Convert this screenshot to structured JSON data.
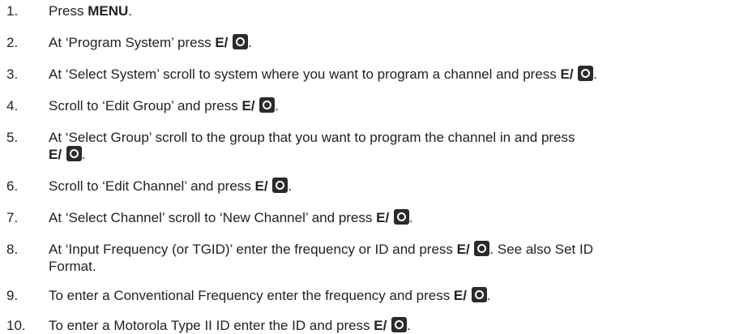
{
  "steps": [
    {
      "number": "1.",
      "pre": "Press ",
      "key": "MENU",
      "post": "."
    },
    {
      "number": "2.",
      "pre": "At ‘Program System’ press ",
      "key": "E/",
      "icon": "enter-button-icon",
      "post": "."
    },
    {
      "number": "3.",
      "pre": "At ‘Select System’ scroll to system where you want to program a channel and press ",
      "key": "E/",
      "icon": "enter-button-icon",
      "post": "."
    },
    {
      "number": "4.",
      "pre": "Scroll to ‘Edit Group’ and press ",
      "key": "E/",
      "icon": "enter-button-icon",
      "post": "."
    },
    {
      "number": "5.",
      "pre": "At ‘Select Group’ scroll to the group that you want to program the channel in and press",
      "key": "E/",
      "icon": "enter-button-icon",
      "post": "."
    },
    {
      "number": "6.",
      "pre": "Scroll to ‘Edit Channel’ and press ",
      "key": "E/",
      "icon": "enter-button-icon",
      "post": "."
    },
    {
      "number": "7.",
      "pre": "At ‘Select Channel’ scroll to ‘New Channel’ and press ",
      "key": "E/",
      "icon": "enter-button-icon",
      "post": "."
    },
    {
      "number": "8.",
      "pre": "At ‘Input Frequency (or TGID)’ enter the frequency or ID and press ",
      "key": "E/",
      "icon": "enter-button-icon",
      "post": ". See also Set ID",
      "post2": "Format."
    },
    {
      "number": "9.",
      "pre": "To enter a Conventional Frequency enter the frequency and press ",
      "key": "E/",
      "icon": "enter-button-icon",
      "post": "."
    },
    {
      "number": "10.",
      "pre": "To enter a Motorola Type II ID enter the ID and press ",
      "key": "E/",
      "icon": "enter-button-icon",
      "post": "."
    }
  ]
}
